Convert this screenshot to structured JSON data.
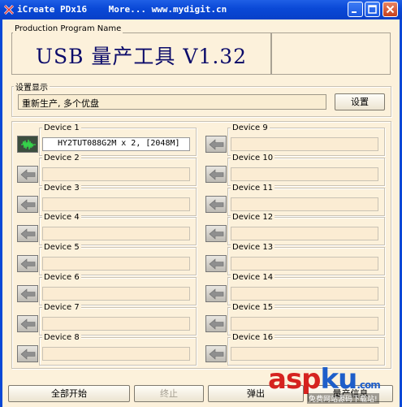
{
  "window": {
    "title": "iCreate PDx16    More... www.mydigit.cn"
  },
  "production": {
    "group_label": "Production Program Name",
    "app_title": "USB 量产工具 V1.32"
  },
  "settings": {
    "group_label": "设置显示",
    "text": "重新生产, 多个优盘",
    "button_label": "设置"
  },
  "devices": [
    {
      "label": "Device 1",
      "info": "HY2TUT088G2M x 2, [2048M]",
      "active": true
    },
    {
      "label": "Device 2",
      "info": ""
    },
    {
      "label": "Device 3",
      "info": ""
    },
    {
      "label": "Device 4",
      "info": ""
    },
    {
      "label": "Device 5",
      "info": ""
    },
    {
      "label": "Device 6",
      "info": ""
    },
    {
      "label": "Device 7",
      "info": ""
    },
    {
      "label": "Device 8",
      "info": ""
    },
    {
      "label": "Device 9",
      "info": ""
    },
    {
      "label": "Device 10",
      "info": ""
    },
    {
      "label": "Device 11",
      "info": ""
    },
    {
      "label": "Device 12",
      "info": ""
    },
    {
      "label": "Device 13",
      "info": ""
    },
    {
      "label": "Device 14",
      "info": ""
    },
    {
      "label": "Device 15",
      "info": ""
    },
    {
      "label": "Device 16",
      "info": ""
    }
  ],
  "bottom": {
    "start_all": "全部开始",
    "stop": "终止",
    "eject": "弹出",
    "info": "量产信息"
  },
  "watermark": {
    "main_a": "asp",
    "main_b": "ku",
    "suffix": ".com",
    "sub": "免费网站源码下载站!"
  },
  "colors": {
    "title_bar": "#0a48d6",
    "background": "#fcf1db",
    "title_text": "#0b0b6a"
  }
}
